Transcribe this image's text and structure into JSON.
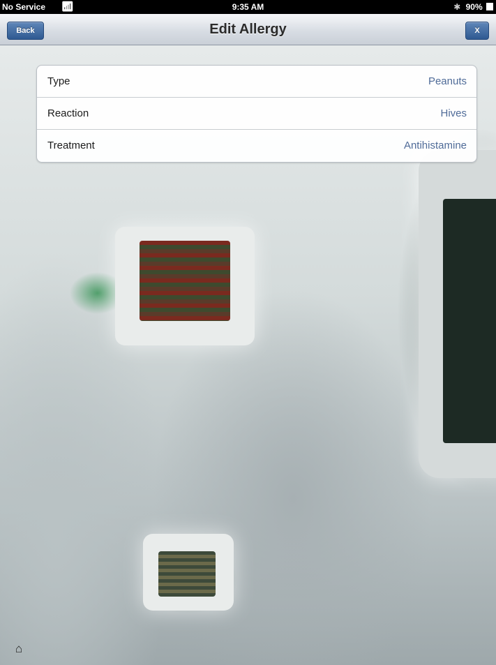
{
  "status_bar": {
    "carrier": "No Service",
    "time": "9:35 AM",
    "battery": "90%"
  },
  "nav": {
    "title": "Edit Allergy",
    "back_label": "Back",
    "close_label": "X"
  },
  "form": {
    "rows": [
      {
        "label": "Type",
        "value": "Peanuts"
      },
      {
        "label": "Reaction",
        "value": "Hives"
      },
      {
        "label": "Treatment",
        "value": "Antihistamine"
      }
    ]
  },
  "icons": {
    "wifi": "wifi-icon",
    "bluetooth": "bluetooth-icon",
    "battery": "battery-icon",
    "home": "home-icon"
  },
  "colors": {
    "nav_button": "#2f5a92",
    "value_text": "#4f6b98"
  }
}
